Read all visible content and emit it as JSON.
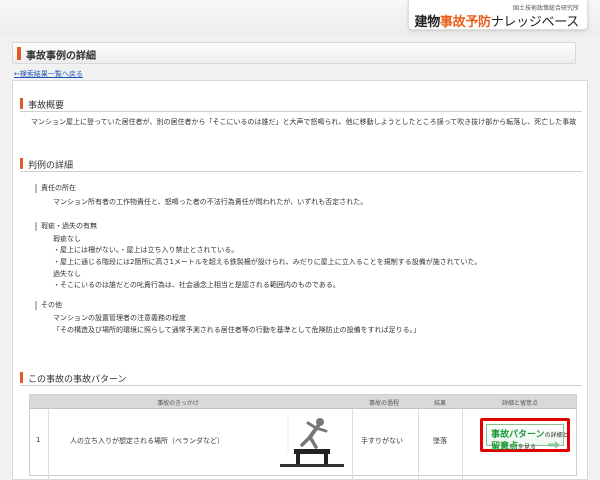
{
  "header": {
    "org": "国土技術政策総合研究所",
    "logo_part1": "建物",
    "logo_accent": "事故予防",
    "logo_part2": "ナレッジベース"
  },
  "page_title": "事故事例の詳細",
  "back_link": "←検索結果一覧へ戻る",
  "overview": {
    "heading": "事故概要",
    "text": "マンション屋上に登っていた居住者が、別の居住者から「そこにいるのは誰だ」と大声で怒鳴られ、他に移動しようとしたところ誤って吹き抜け部から転落し、死亡した事故"
  },
  "judgment": {
    "heading": "判例の詳細",
    "responsibility_title": "責任の所在",
    "responsibility_text": "マンション所有者の工作物責任と、怒鳴った者の不法行為責任が問われたが、いずれも否定された。",
    "defect_title": "瑕疵・過失の有無",
    "defect_lines": [
      "瑕疵なし",
      "・屋上には柵がない。・屋上は立ち入り禁止とされている。",
      "・屋上に通じる階段には2箇所に高さ1メートルを超える鉄製柵が設けられ、みだりに屋上に立入ることを規制する設備が施されていた。",
      "過失なし",
      "・そこにいるのは誰だとの叱責行為は、社会通念上相当と是認される範囲内のものである。"
    ],
    "other_title": "その他",
    "other_lines": [
      "マンションの設置管理者の注意義務の程度",
      "「その構造及び場所的環境に照らして通常予測される居住者等の行動を基準として危険防止の設備をすれば足りる。」"
    ]
  },
  "pattern": {
    "heading": "この事故の事故パターン",
    "columns": [
      "事故のきっかけ",
      "事故の過程",
      "結果",
      "詳細と留意点"
    ],
    "rows": [
      {
        "no": "1",
        "trigger": "人の立ち入りが想定される場所（ベランダなど）",
        "process": "手すりがない",
        "result": "墜落"
      }
    ],
    "button": {
      "line1": "事故パターン",
      "line1_small": "の詳細と",
      "line2": "留意点",
      "line2_small": "を見る"
    }
  },
  "colors": {
    "accent": "#e05a2a",
    "button_green": "#1a9a3a",
    "highlight_red": "#e00000",
    "link": "#2255bb"
  }
}
